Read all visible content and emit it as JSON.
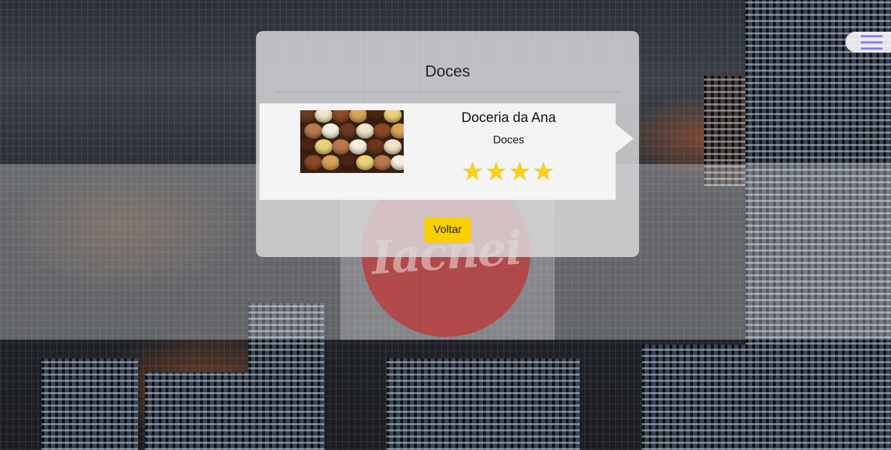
{
  "background": {
    "logo_text": "Iacnei"
  },
  "menu": {
    "icon": "hamburger-menu-icon",
    "accent": "#8d7df0"
  },
  "panel": {
    "title": "Doces"
  },
  "card": {
    "image_icon": "chocolates-image",
    "name": "Doceria da Ana",
    "category": "Doces",
    "rating": 4,
    "rating_max": 4,
    "star_char": "★",
    "star_color": "#f6d21b"
  },
  "actions": {
    "back_label": "Voltar",
    "back_color": "#f8d000"
  }
}
